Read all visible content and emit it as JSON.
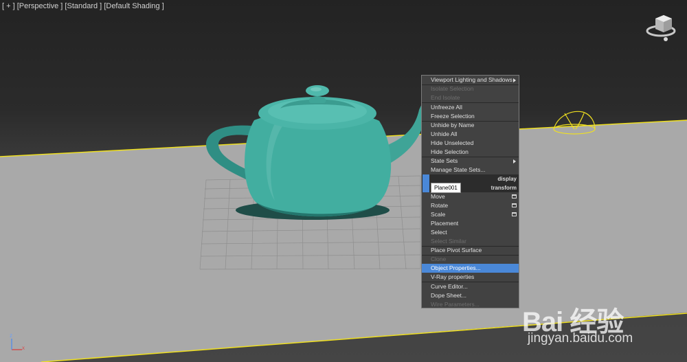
{
  "viewport": {
    "label": {
      "plus": "[ + ]",
      "view": "[Perspective ]",
      "mode": "[Standard ]",
      "shading": "[Default Shading ]"
    },
    "teapot_color": "#40a89c",
    "selection_color": "#f0e020"
  },
  "quad_menu": {
    "display_header": "display",
    "transform_header": "transform",
    "tooltip": "Plane001",
    "display_items": [
      {
        "label": "Viewport Lighting and Shadows",
        "submenu": true,
        "enabled": true
      },
      {
        "label": "Isolate Selection",
        "enabled": false
      },
      {
        "label": "End Isolate",
        "enabled": false
      },
      {
        "label": "Unfreeze All",
        "enabled": true
      },
      {
        "label": "Freeze Selection",
        "enabled": true
      },
      {
        "label": "Unhide by Name",
        "enabled": true
      },
      {
        "label": "Unhide All",
        "enabled": true
      },
      {
        "label": "Hide Unselected",
        "enabled": true
      },
      {
        "label": "Hide Selection",
        "enabled": true
      },
      {
        "label": "State Sets",
        "submenu": true,
        "enabled": true
      },
      {
        "label": "Manage State Sets...",
        "enabled": true
      }
    ],
    "transform_items": [
      {
        "label": "Move",
        "settings": true,
        "enabled": true
      },
      {
        "label": "Rotate",
        "settings": true,
        "enabled": true
      },
      {
        "label": "Scale",
        "settings": true,
        "enabled": true
      },
      {
        "label": "Placement",
        "enabled": true
      },
      {
        "label": "Select",
        "enabled": true
      },
      {
        "label": "Select Similar",
        "enabled": false
      },
      {
        "label": "Place Pivot Surface",
        "enabled": true
      },
      {
        "label": "Clone",
        "enabled": false
      },
      {
        "label": "Object Properties...",
        "enabled": true,
        "highlighted": true
      },
      {
        "label": "V-Ray properties",
        "enabled": true
      },
      {
        "label": "Curve Editor...",
        "enabled": true
      },
      {
        "label": "Dope Sheet...",
        "enabled": true
      },
      {
        "label": "Wire Parameters...",
        "enabled": false
      }
    ]
  },
  "watermark": {
    "logo": "Bai 经验",
    "url": "jingyan.baidu.com"
  },
  "axis": {
    "x": "x",
    "z": "z"
  }
}
